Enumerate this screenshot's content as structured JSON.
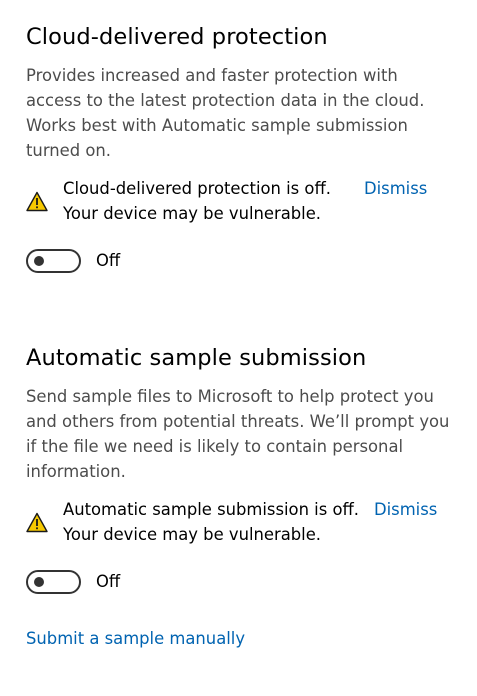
{
  "cloud_protection": {
    "title": "Cloud-delivered protection",
    "description": "Provides increased and faster protection with access to the latest protection data in the cloud. Works best with Automatic sample submission turned on.",
    "warning_line1": "Cloud-delivered protection is off.",
    "warning_line2": "Your device may be vulnerable.",
    "dismiss_label": "Dismiss",
    "toggle_state": "Off",
    "toggle_on": false
  },
  "sample_submission": {
    "title": "Automatic sample submission",
    "description": "Send sample files to Microsoft to help protect you and others from potential threats. We’ll prompt you if the file we need is likely to contain personal information.",
    "warning_line1": "Automatic sample submission is off.",
    "warning_line2": "Your device may be vulnerable.",
    "dismiss_label": "Dismiss",
    "toggle_state": "Off",
    "toggle_on": false
  },
  "submit_manual_link": "Submit a sample manually",
  "icons": {
    "warning": "warning-triangle-icon"
  },
  "colors": {
    "link": "#0063b1",
    "warning_fill": "#f7c900",
    "description_text": "#4c4c4c",
    "toggle_off": "#333333"
  }
}
